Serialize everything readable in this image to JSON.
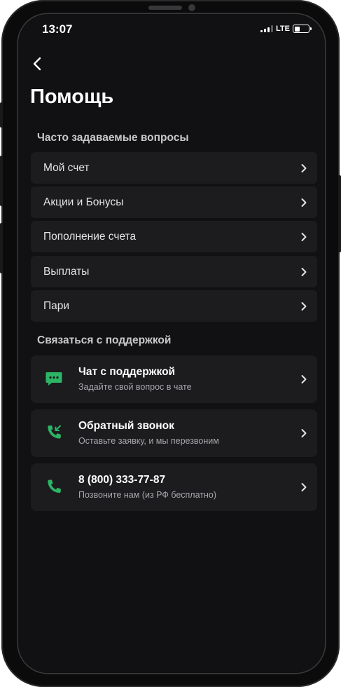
{
  "status_bar": {
    "time": "13:07",
    "network": "LTE"
  },
  "page": {
    "title": "Помощь"
  },
  "faq": {
    "heading": "Часто задаваемые вопросы",
    "items": [
      {
        "label": "Мой счет"
      },
      {
        "label": "Акции и Бонусы"
      },
      {
        "label": "Пополнение счета"
      },
      {
        "label": "Выплаты"
      },
      {
        "label": "Пари"
      }
    ]
  },
  "support": {
    "heading": "Связаться с поддержкой",
    "items": [
      {
        "icon": "chat-icon",
        "title": "Чат с поддержкой",
        "subtitle": "Задайте свой вопрос в чате"
      },
      {
        "icon": "callback-phone-icon",
        "title": "Обратный звонок",
        "subtitle": "Оставьте заявку, и мы перезвоним"
      },
      {
        "icon": "phone-icon",
        "title": "8 (800) 333-77-87",
        "subtitle": "Позвоните нам (из РФ бесплатно)"
      }
    ]
  },
  "colors": {
    "background": "#111113",
    "item_background": "#1c1c1f",
    "accent_green": "#2bb565",
    "text_primary": "#ffffff",
    "text_secondary": "#a8a8ac"
  }
}
